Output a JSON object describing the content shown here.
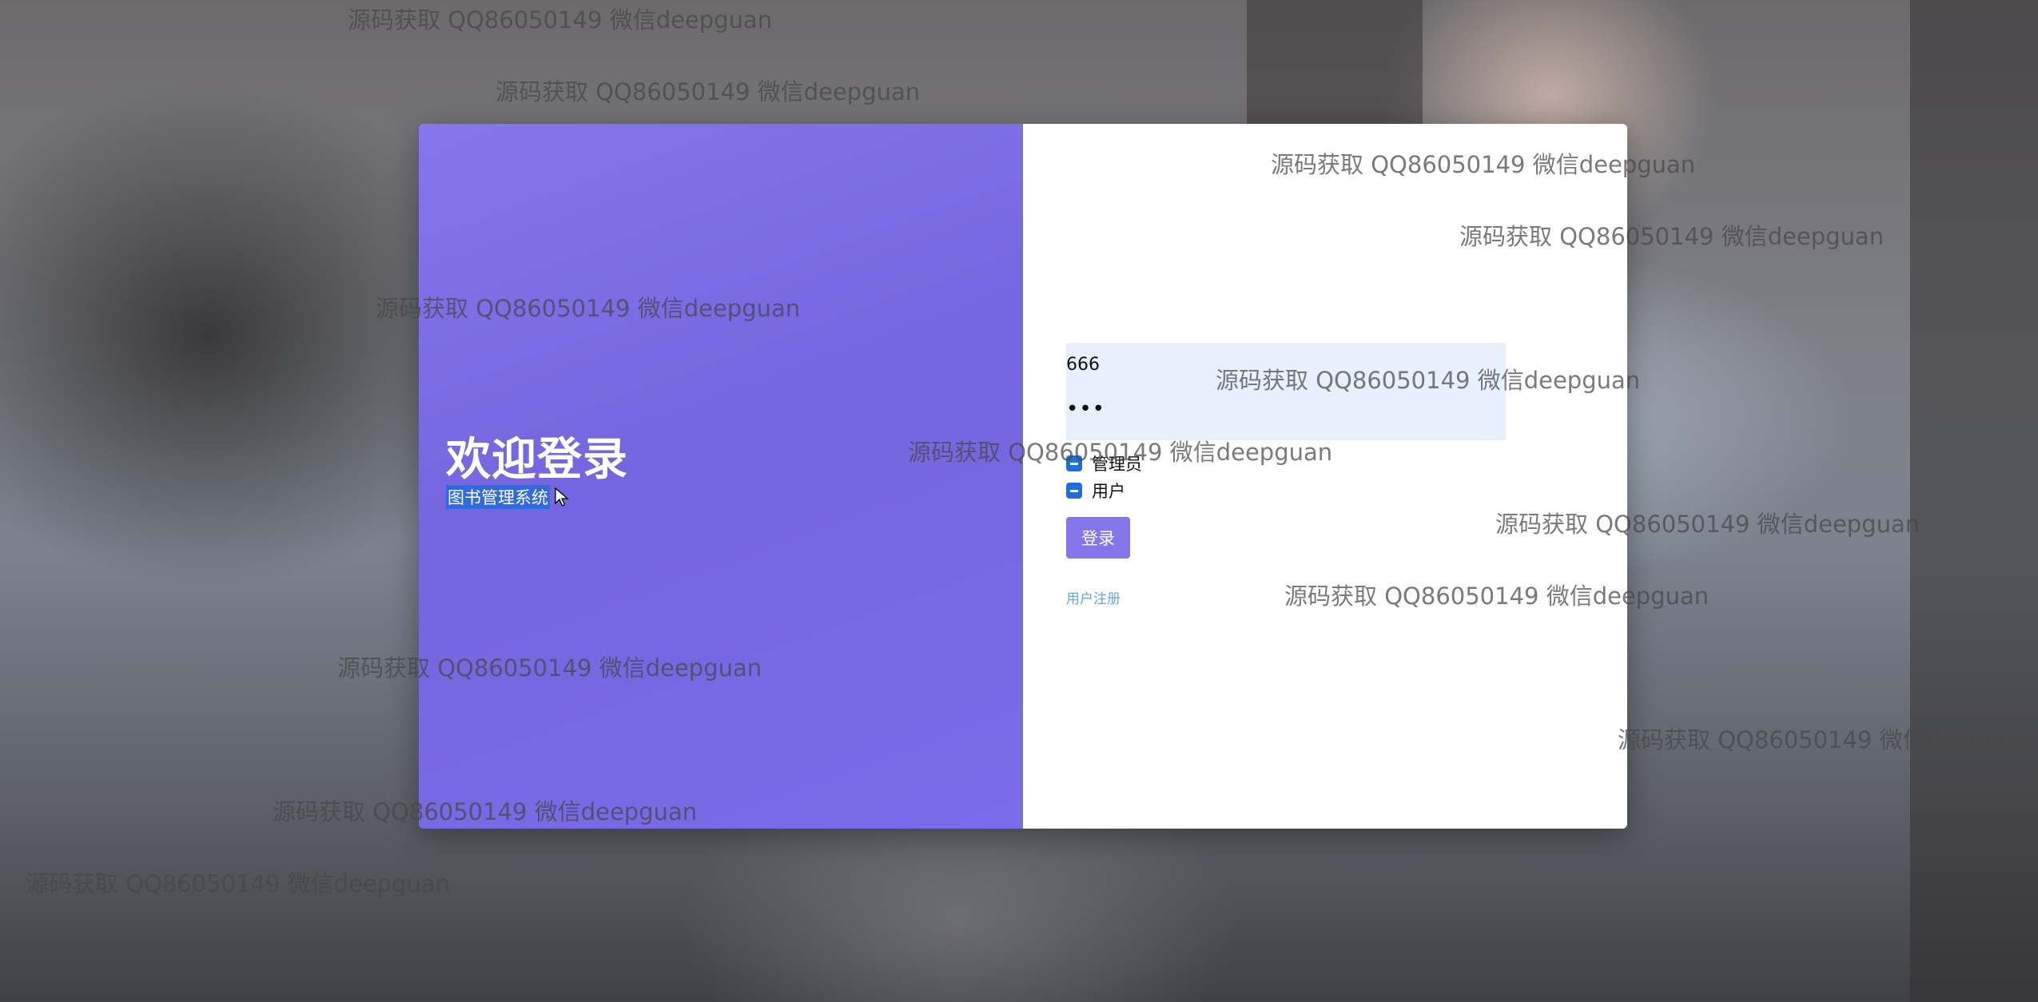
{
  "login": {
    "welcome_title": "欢迎登录",
    "subtitle": "图书管理系统",
    "username_value": "666",
    "password_value": "•••",
    "roles": [
      {
        "label": "管理员",
        "checked": true
      },
      {
        "label": "用户",
        "checked": true
      }
    ],
    "login_button": "登录",
    "register_link": "用户注册"
  },
  "watermark_text": "源码获取 QQ86050149 微信deepguan",
  "colors": {
    "left_panel": "#7a6be8",
    "button": "#8475ea",
    "checkbox": "#1e6fd9",
    "link": "#6aa6d8",
    "selection": "#2f6bdc"
  },
  "icons": {
    "cursor": "mouse-pointer-icon",
    "checkbox": "checkbox-indeterminate-icon"
  }
}
